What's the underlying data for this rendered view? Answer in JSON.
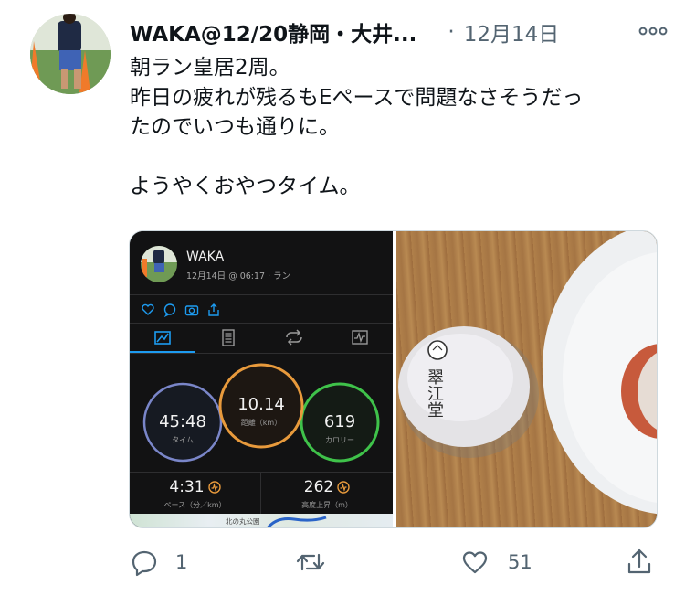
{
  "tweet": {
    "display_name": "WAKA@12/20静岡・大井...",
    "separator": "·",
    "date": "12月14日",
    "text": "朝ラン皇居2周。\n昨日の疲れが残るもEペースで問題なさそうだっ\nたのでいつも通りに。\n\nようやくおやつタイム。"
  },
  "garmin": {
    "user": "WAKA",
    "activity_meta": "12月14日 @ 06:17 · ラン",
    "time_value": "45:48",
    "time_label": "タイム",
    "distance_value": "10.14",
    "distance_label": "距離（km）",
    "calories_value": "619",
    "calories_label": "カロリー",
    "pace_value": "4:31",
    "pace_label": "ペース（分／km）",
    "elevation_value": "262",
    "elevation_label": "高度上昇（m）",
    "map_label": "北の丸公園"
  },
  "snack": {
    "wrapper_text": "翠江堂"
  },
  "actions": {
    "reply_count": "1",
    "retweet_count": "",
    "like_count": "51"
  },
  "colors": {
    "time_ring": "#7a86c9",
    "distance_ring": "#e89a3c",
    "calories_ring": "#3fc24a",
    "accent_blue": "#1d9bf0",
    "muted": "#536471"
  }
}
